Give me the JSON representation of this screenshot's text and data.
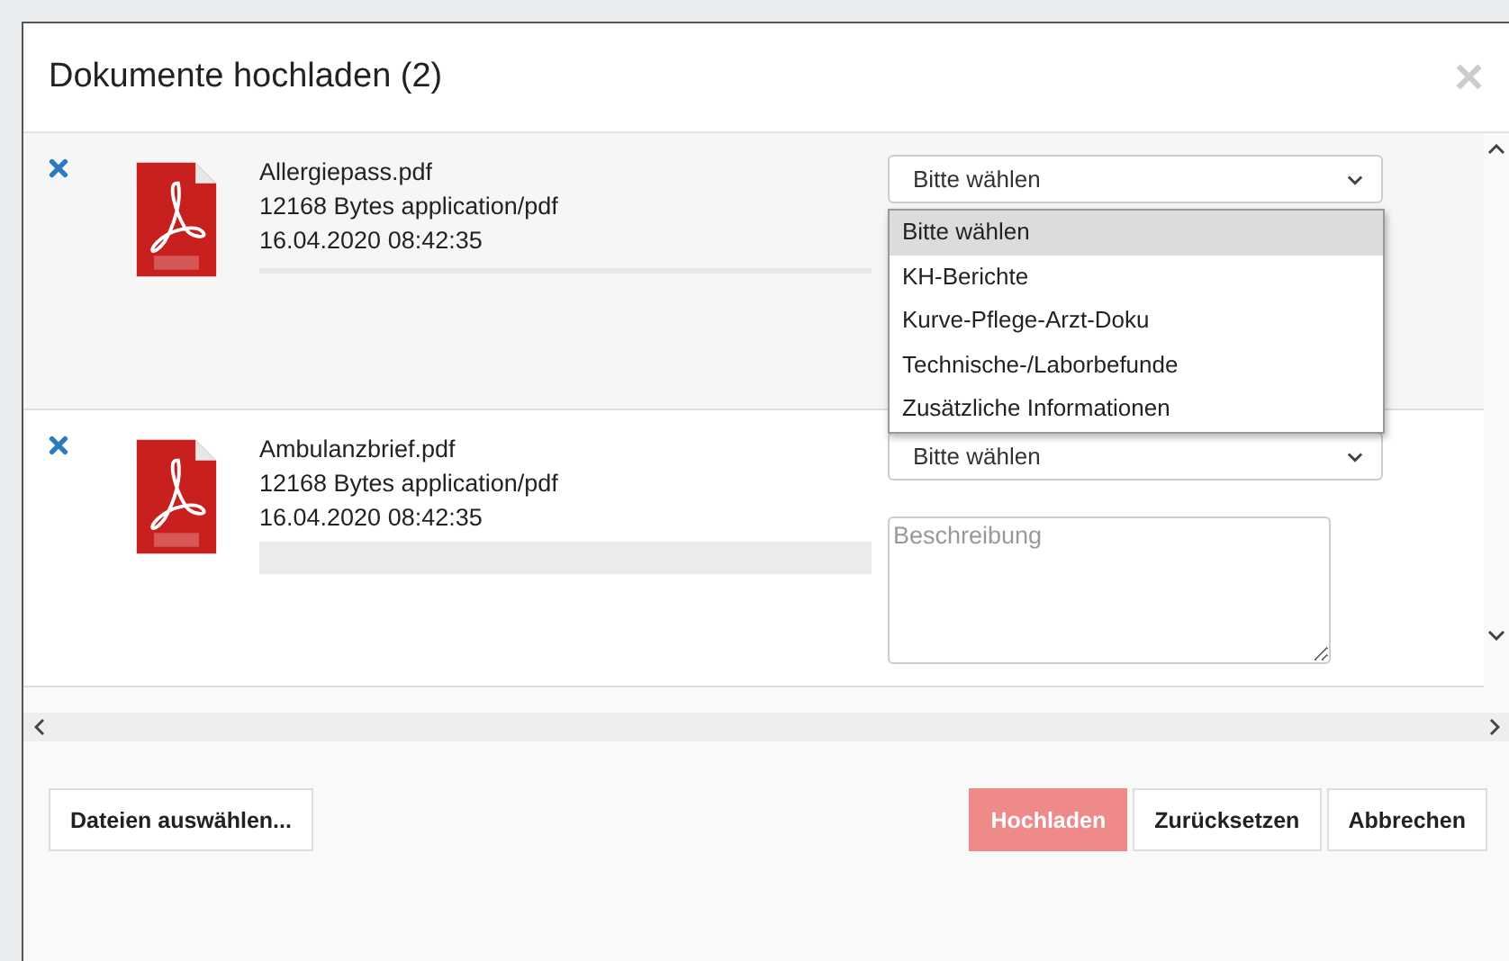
{
  "dialog": {
    "title": "Dokumente hochladen (2)",
    "close": "×"
  },
  "files": [
    {
      "name": "Allergiepass.pdf",
      "size": "12168 Bytes application/pdf",
      "date": "16.04.2020 08:42:35",
      "category": "Bitte wählen",
      "expanded": true,
      "options": [
        {
          "label": "Bitte wählen",
          "selected": true
        },
        {
          "label": "KH-Berichte",
          "selected": false
        },
        {
          "label": "Kurve-Pflege-Arzt-Doku",
          "selected": false
        },
        {
          "label": "Technische-/Laborbefunde",
          "selected": false
        },
        {
          "label": "Zusätzliche Informationen",
          "selected": false
        }
      ]
    },
    {
      "name": "Ambulanzbrief.pdf",
      "size": "12168 Bytes application/pdf",
      "date": "16.04.2020 08:42:35",
      "category": "Bitte wählen",
      "expanded": false,
      "description_placeholder": "Beschreibung"
    }
  ],
  "footer": {
    "select_files": "Dateien auswählen...",
    "buttons": [
      {
        "label": "Hochladen",
        "kind": "primary",
        "disabled": true
      },
      {
        "label": "Zurücksetzen",
        "kind": "default",
        "disabled": false
      },
      {
        "label": "Abbrechen",
        "kind": "default",
        "disabled": false
      }
    ]
  }
}
